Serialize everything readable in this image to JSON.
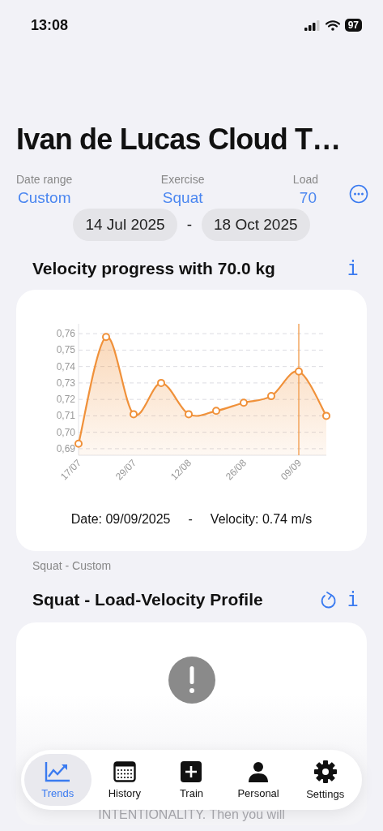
{
  "status_bar": {
    "time": "13:08",
    "battery": "97"
  },
  "title": "Ivan de Lucas Cloud T…",
  "filters": [
    {
      "label": "Date range",
      "value": "Custom"
    },
    {
      "label": "Exercise",
      "value": "Squat"
    },
    {
      "label": "Load",
      "value": "70"
    }
  ],
  "date_range": {
    "start": "14 Jul 2025",
    "separator": "-",
    "end": "18 Oct 2025"
  },
  "velocity_section": {
    "heading": "Velocity progress with 70.0 kg",
    "info": "i",
    "chart_data": {
      "type": "area",
      "categories": [
        "17/07",
        null,
        "29/07",
        null,
        "12/08",
        null,
        "26/08",
        null,
        "09/09",
        null
      ],
      "series": [
        {
          "color": "#f0913a",
          "values": [
            0.693,
            0.758,
            0.711,
            0.73,
            0.711,
            0.713,
            0.718,
            0.722,
            0.737,
            0.71
          ]
        }
      ],
      "ylim": [
        0.686,
        0.766
      ],
      "grid": true,
      "yticks": [
        {
          "value": 0.69,
          "label": "0,69"
        },
        {
          "value": 0.7,
          "label": "0,70"
        },
        {
          "value": 0.71,
          "label": "0,71"
        },
        {
          "value": 0.72,
          "label": "0,72"
        },
        {
          "value": 0.73,
          "label": "0,73"
        },
        {
          "value": 0.74,
          "label": "0,74"
        },
        {
          "value": 0.75,
          "label": "0,75"
        },
        {
          "value": 0.76,
          "label": "0,76"
        }
      ],
      "ref_lines": [
        {
          "axis": "x",
          "value": "09/09"
        }
      ]
    },
    "readout": {
      "date": "Date: 09/09/2025",
      "separator": "-",
      "velocity": "Velocity: 0.74 m/s"
    }
  },
  "caption": "Squat - Custom",
  "profile_section": {
    "heading": "Squat - Load-Velocity Profile",
    "info": "i",
    "message": "INTENTIONALITY. Then you will"
  },
  "tabs": [
    {
      "label": "Trends",
      "kind": "trends",
      "selected": true
    },
    {
      "label": "History",
      "kind": "history",
      "selected": false
    },
    {
      "label": "Train",
      "kind": "train",
      "selected": false
    },
    {
      "label": "Personal",
      "kind": "personal",
      "selected": false
    },
    {
      "label": "Settings",
      "kind": "settings",
      "selected": false
    }
  ]
}
